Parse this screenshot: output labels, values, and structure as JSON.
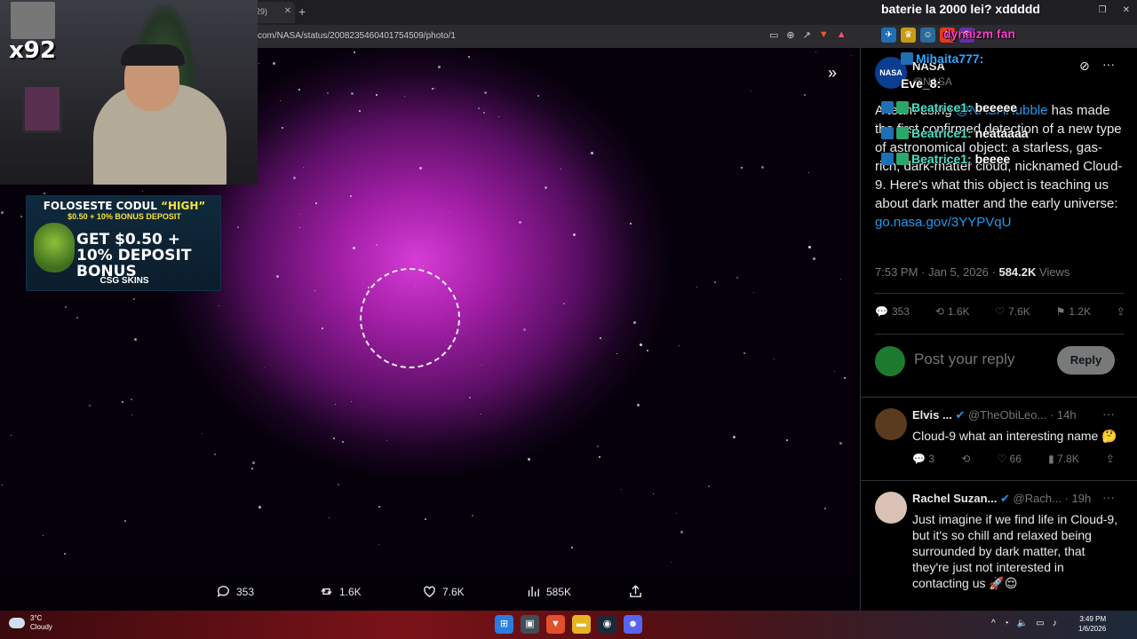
{
  "browser": {
    "tab_label": "29)",
    "url": "com/NASA/status/2008235460401754509/photo/1",
    "new_tab": "+"
  },
  "media_actions": {
    "replies": "353",
    "reposts": "1.6K",
    "likes": "7.6K",
    "views": "585K"
  },
  "overlay": {
    "multiplier": "x92",
    "stream_title": "baterie la 2000 lei? xddddd"
  },
  "ad": {
    "line1_prefix": "FOLOSESTE CODUL ",
    "line1_code": "“HIGH”",
    "line2": "$0.50 + 10% BONUS DEPOSIT",
    "headline": "GET $0.50 + 10% DEPOSIT BONUS",
    "brand": "CSG SKINS"
  },
  "tweet": {
    "author": "NASA",
    "handle": "@NASA",
    "avatar_text": "NASA",
    "text_before": "A team using ",
    "mention": "@NASAHubble",
    "text_after": " has made the first confirmed detection of a new type of astronomical object: a starless, gas-rich, dark-matter cloud, nicknamed Cloud-9. Here's what this object is teaching us about dark matter and the early universe:",
    "link": "go.nasa.gov/3YYPVqU",
    "time": "7:53 PM · Jan 5, 2026 · ",
    "views_count": "584.2K",
    "views_label": " Views",
    "replies": "353",
    "reposts": "1.6K",
    "likes": "7.6K",
    "bookmarks": "1.2K",
    "reply_placeholder": "Post your reply",
    "reply_button": "Reply"
  },
  "replies": [
    {
      "name": "Elvis ...",
      "handle": "@TheObiLeo...",
      "time": "· 14h",
      "text": "Cloud-9 what an interesting name 🤔",
      "replies": "3",
      "reposts": "",
      "likes": "66",
      "views": "7.8K",
      "avatar_color": "#5b3b1e"
    },
    {
      "name": "Rachel Suzan...",
      "handle": "@Rach...",
      "time": "· 19h",
      "text": "Just imagine if we find life in Cloud-9, but it's so chill and relaxed being surrounded by dark matter, that they're just not interested in contacting us 🚀😌",
      "avatar_color": "#d9c2b5"
    }
  ],
  "chat": [
    {
      "user": "Mihaita777:",
      "message": "",
      "color": "#2fa5ff"
    },
    {
      "user": "Eve_8:",
      "message": "",
      "color": "#ffffff"
    },
    {
      "user": "Beatrice1:",
      "message": "beeeee",
      "color": "#4de0c6"
    },
    {
      "user": "Beatrice1:",
      "message": "neataaaa",
      "color": "#4de0c6"
    },
    {
      "user": "Beatrice1:",
      "message": "beeee",
      "color": "#4de0c6"
    },
    {
      "user": "dynaizm fan",
      "message": "",
      "color": "#ff3fd1"
    }
  ],
  "taskbar": {
    "temperature": "3°C",
    "condition": "Cloudy",
    "time": "3:49 PM",
    "date": "1/6/2026"
  },
  "colors": {
    "accent": "#1d9bf0",
    "nebula": "#d63cd6",
    "panel_bg": "#000000",
    "muted": "#71767b"
  }
}
